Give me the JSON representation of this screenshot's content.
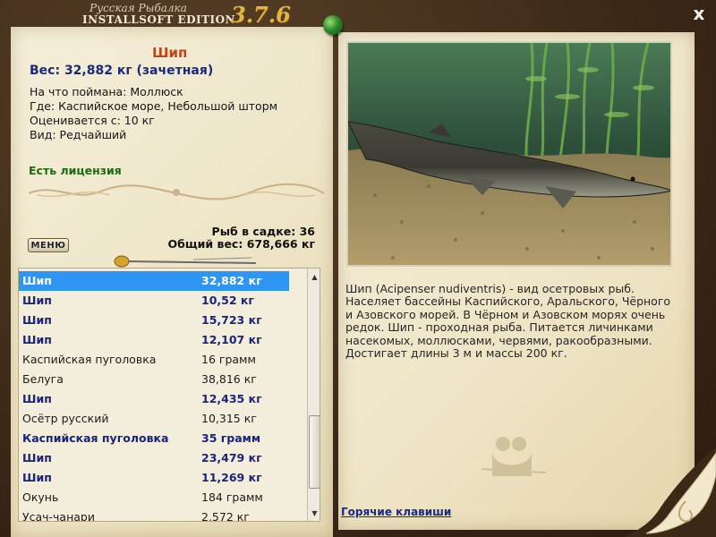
{
  "app": {
    "title_line1": "Русская Рыбалка",
    "title_line2": "INSTALLSOFT EDITION",
    "version": "3.7.6",
    "close_label": "x"
  },
  "catch": {
    "fish_name": "Шип",
    "weight_line": "Вес: 32,882 кг (зачетная)",
    "bait_line": "На что поймана: Моллюск",
    "place_line": "Где: Каспийское море, Небольшой шторм",
    "value_line": "Оценивается с: 10 кг",
    "kind_line": "Вид: Редчайший",
    "license": "Есть лицензия"
  },
  "keepnet": {
    "count_line": "Рыб в садке: 36",
    "total_line": "Общий вес: 678,666 кг"
  },
  "menu_label": "МЕНЮ",
  "list": {
    "rows": [
      {
        "name": "Шип",
        "weight": "32,882 кг",
        "style": "sel"
      },
      {
        "name": "Шип",
        "weight": "10,52 кг",
        "style": "bold"
      },
      {
        "name": "Шип",
        "weight": "15,723 кг",
        "style": "bold"
      },
      {
        "name": "Шип",
        "weight": "12,107 кг",
        "style": "bold"
      },
      {
        "name": "Каспийская пуголовка",
        "weight": "16 грамм",
        "style": "normal"
      },
      {
        "name": "Белуга",
        "weight": "38,816 кг",
        "style": "normal"
      },
      {
        "name": "Шип",
        "weight": "12,435 кг",
        "style": "bold"
      },
      {
        "name": "Осётр русский",
        "weight": "10,315 кг",
        "style": "normal"
      },
      {
        "name": "Каспийская пуголовка",
        "weight": "35 грамм",
        "style": "bold"
      },
      {
        "name": "Шип",
        "weight": "23,479 кг",
        "style": "bold"
      },
      {
        "name": "Шип",
        "weight": "11,269 кг",
        "style": "bold"
      },
      {
        "name": "Окунь",
        "weight": "184 грамм",
        "style": "normal"
      },
      {
        "name": "Усач-чанари",
        "weight": "2,572 кг",
        "style": "normal"
      }
    ],
    "scroll_up_icon": "▲",
    "scroll_down_icon": "▼"
  },
  "description": {
    "text": "Шип (Acipenser nudiventris) - вид осетровых рыб. Населяет бассейны Каспийского, Аральского, Чёрного и Азовского морей. В Чёрном и Азовском морях очень редок. Шип - проходная рыба. Питается личинками насекомых, моллюсками, червями, ракообразными. Достигает длины 3 м и массы 200 кг."
  },
  "hotkeys_label": "Горячие клавиши",
  "colors": {
    "selected_row": "#2e95f2",
    "fish_title": "#c4441a",
    "weight_text": "#1a2a7a",
    "license_text": "#1e6a10",
    "accent_gold": "#e2b640"
  },
  "icons": {
    "close": "close-icon",
    "pin": "green-pin-icon",
    "scroll_up": "up-arrow-icon",
    "scroll_down": "down-arrow-icon"
  }
}
